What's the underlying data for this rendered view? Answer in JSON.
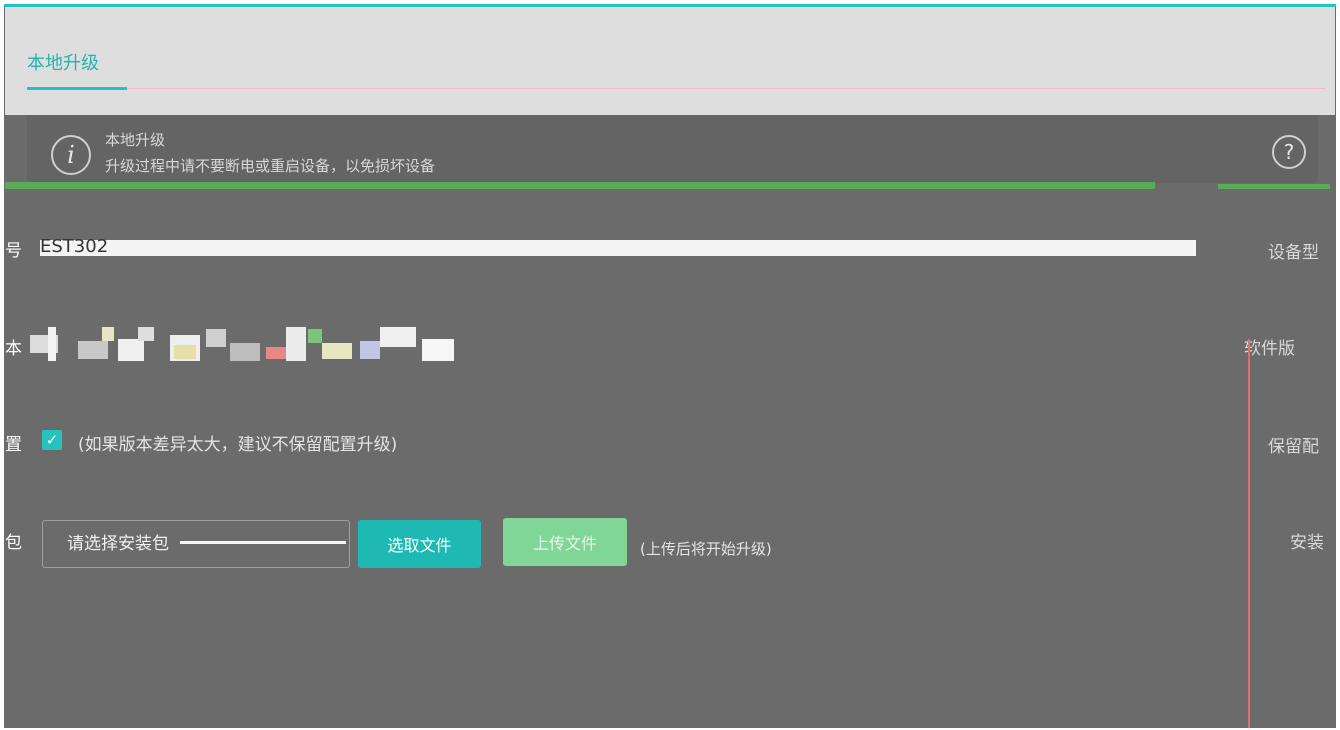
{
  "tabs": {
    "active": "本地升级"
  },
  "info": {
    "title": "本地升级",
    "description": "升级过程中请不要断电或重启设备，以免损坏设备"
  },
  "form": {
    "model_label_fragment": "号",
    "model_value": "EST302",
    "version_label_fragment": "本",
    "keep_label_fragment": "置",
    "keep_note": "(如果版本差异太大，建议不保留配置升级)",
    "keep_checked": true,
    "package_label_fragment": "包",
    "package_placeholder": "请选择安装包",
    "select_button": "选取文件",
    "upload_button": "上传文件",
    "upload_note": "(上传后将开始升级)"
  },
  "right_panel": {
    "model_label": "设备型",
    "version_label": "软件版",
    "keep_label": "保留配",
    "package_label": "安装"
  },
  "colors": {
    "accent": "#26c2bd",
    "upload_button": "#80d696",
    "background": "#6b6b6b"
  }
}
